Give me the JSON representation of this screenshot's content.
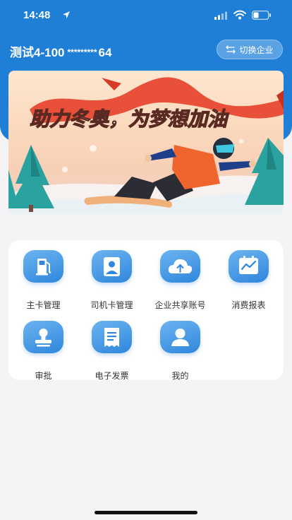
{
  "status_bar": {
    "time": "14:48"
  },
  "header": {
    "company_prefix": "测试4-100",
    "company_masked": "*********",
    "company_suffix": "64",
    "switch_label": "切换企业"
  },
  "banner": {
    "slogan": "助力冬奥，为梦想加油"
  },
  "menu": {
    "items": [
      {
        "label": "主卡管理",
        "icon": "fuel-pump-icon"
      },
      {
        "label": "司机卡管理",
        "icon": "driver-card-icon"
      },
      {
        "label": "企业共享账号",
        "icon": "cloud-upload-icon"
      },
      {
        "label": "消费报表",
        "icon": "chart-report-icon"
      },
      {
        "label": "审批",
        "icon": "stamp-icon"
      },
      {
        "label": "电子发票",
        "icon": "receipt-icon"
      },
      {
        "label": "我的",
        "icon": "user-icon"
      }
    ]
  },
  "colors": {
    "brand_blue": "#1f7fd6",
    "page_bg": "#f4f4f6",
    "banner_red": "#e8503a"
  }
}
